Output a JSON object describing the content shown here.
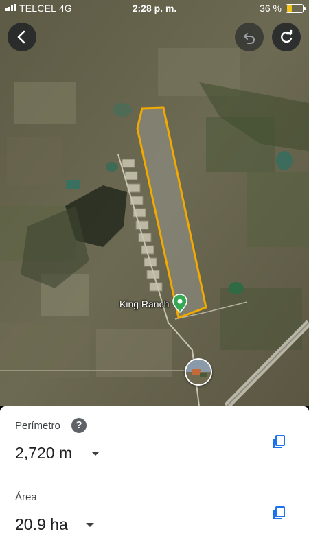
{
  "status_bar": {
    "carrier": "TELCEL",
    "network": "4G",
    "time": "2:28 p. m.",
    "battery_percent": "36 %",
    "battery_level": 0.36
  },
  "map": {
    "place_label": "King Ranch"
  },
  "measurements": {
    "perimeter": {
      "label": "Perímetro",
      "value": "2,720 m"
    },
    "area": {
      "label": "Área",
      "value": "20.9 ha"
    }
  },
  "icons": {
    "back": "arrow-left-icon",
    "undo": "undo-icon",
    "redo": "redo-icon",
    "help": "help-icon",
    "copy": "copy-icon",
    "pin": "map-pin-icon"
  },
  "colors": {
    "polygon": "#f2a900",
    "accent": "#1a73e8",
    "pin": "#34a853"
  }
}
